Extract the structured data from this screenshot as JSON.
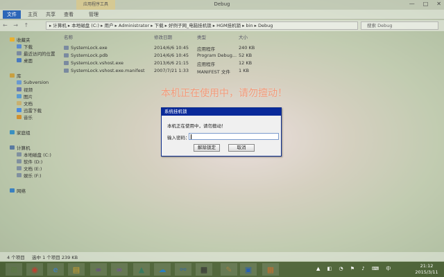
{
  "window": {
    "title": "Debug",
    "context_tab": "应用程序工具",
    "controls": [
      "—",
      "□",
      "✕"
    ]
  },
  "ribbon": {
    "file": "文件",
    "tabs": [
      "主页",
      "共享",
      "查看",
      "管理"
    ]
  },
  "address": {
    "nav": "← → ↑",
    "path": "▸ 计算机 ▸ 本地磁盘 (C:) ▸ 用户 ▸ Administrator ▸ 下载 ▸ 好例子网_电脑挂机锁 ▸ HGM挂机锁 ▸ bin ▸ Debug",
    "search_placeholder": "搜索 Debug"
  },
  "nav": [
    {
      "label": "收藏夹",
      "icon": "star-icon",
      "color": "#e8b030"
    },
    {
      "label": "下载",
      "icon": "download-folder-icon",
      "color": "#5a8ad0"
    },
    {
      "label": "最近访问的位置",
      "icon": "recent-places-icon",
      "color": "#7a8aa0"
    },
    {
      "label": "桌面",
      "icon": "desktop-icon",
      "color": "#4a7ac0"
    },
    {
      "label": "库",
      "icon": "library-icon",
      "color": "#c8a040"
    },
    {
      "label": "Subversion",
      "icon": "subversion-icon",
      "color": "#6a9ad0"
    },
    {
      "label": "视频",
      "icon": "video-icon",
      "color": "#6a7ab0"
    },
    {
      "label": "图片",
      "icon": "pictures-icon",
      "color": "#5a9ad0"
    },
    {
      "label": "文档",
      "icon": "documents-icon",
      "color": "#c8b070"
    },
    {
      "label": "迅雷下载",
      "icon": "thunder-download-icon",
      "color": "#4a8ae0"
    },
    {
      "label": "音乐",
      "icon": "music-icon",
      "color": "#d09030"
    },
    {
      "label": "家庭组",
      "icon": "homegroup-icon",
      "color": "#3a90c0"
    },
    {
      "label": "计算机",
      "icon": "computer-icon",
      "color": "#5a7aa0"
    },
    {
      "label": "本地磁盘 (C:)",
      "icon": "drive-icon",
      "color": "#8090a0"
    },
    {
      "label": "软件 (D:)",
      "icon": "drive-icon",
      "color": "#8090a0"
    },
    {
      "label": "文档 (E:)",
      "icon": "drive-icon",
      "color": "#8090a0"
    },
    {
      "label": "娱乐 (F:)",
      "icon": "drive-icon",
      "color": "#8090a0"
    },
    {
      "label": "网络",
      "icon": "network-icon",
      "color": "#3a80c0"
    }
  ],
  "columns": {
    "name": "名称",
    "date": "修改日期",
    "type": "类型",
    "size": "大小"
  },
  "files": [
    {
      "name": "SystemLock.exe",
      "date": "2014/6/6 10:45",
      "type": "应用程序",
      "size": "240 KB"
    },
    {
      "name": "SystemLock.pdb",
      "date": "2014/6/6 10:45",
      "type": "Program Debug...",
      "size": "52 KB"
    },
    {
      "name": "SystemLock.vshost.exe",
      "date": "2013/6/6 21:15",
      "type": "应用程序",
      "size": "12 KB"
    },
    {
      "name": "SystemLock.vshost.exe.manifest",
      "date": "2007/7/21 1:33",
      "type": "MANIFEST 文件",
      "size": "1 KB"
    }
  ],
  "status": {
    "count": "4 个项目",
    "selected": "选中 1 个项目  239 KB"
  },
  "lock_message": "本机正在使用中，请勿擅动！",
  "dialog": {
    "title": "系统挂机锁",
    "message": "本机正在使用中，请勿擅动！",
    "password_label": "输入密码：",
    "password_value": "",
    "unlock_label": "解除锁定",
    "cancel_label": "取消"
  },
  "taskbar": {
    "apps": [
      {
        "name": "start-button",
        "glyph": "⊞",
        "color": "#5a7a40"
      },
      {
        "name": "chrome-app",
        "glyph": "◉",
        "color": "#c04030"
      },
      {
        "name": "ie-app",
        "glyph": "e",
        "color": "#3a80d0"
      },
      {
        "name": "explorer-app",
        "glyph": "▤",
        "color": "#d0a030"
      },
      {
        "name": "visual-studio-app",
        "glyph": "∞",
        "color": "#6a3aa0"
      },
      {
        "name": "visual-studio-2-app",
        "glyph": "∞",
        "color": "#7a4ab0"
      },
      {
        "name": "sql-app",
        "glyph": "▲",
        "color": "#3a7a60"
      },
      {
        "name": "qq-app",
        "glyph": "☁",
        "color": "#2a80c0"
      },
      {
        "name": "network-app",
        "glyph": "⚯",
        "color": "#3a6a9a"
      },
      {
        "name": "terminal-app",
        "glyph": "▦",
        "color": "#303030"
      },
      {
        "name": "notes-app",
        "glyph": "✎",
        "color": "#a08040"
      },
      {
        "name": "app-blue",
        "glyph": "▣",
        "color": "#2a60b0"
      },
      {
        "name": "app-tile",
        "glyph": "▦",
        "color": "#c07030"
      }
    ],
    "tray": "▲ ◧ ◔ ⚑ ♪ ⌨ 中",
    "time": "21:12",
    "date": "2015/3/11"
  }
}
